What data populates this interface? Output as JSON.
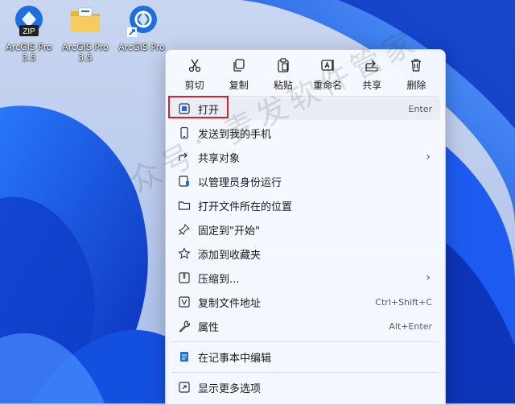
{
  "desktop": {
    "icons": [
      {
        "badge": "ZIP",
        "label": "ArcGIS Pro 3.5"
      },
      {
        "label": "ArcGIS Pro 3.5"
      },
      {
        "label": "ArcGIS Pro"
      }
    ]
  },
  "toolbar": {
    "cut": "剪切",
    "copy": "复制",
    "paste": "粘贴",
    "rename": "重命名",
    "share": "共享",
    "delete": "删除"
  },
  "menu": {
    "items": [
      {
        "label": "打开",
        "shortcut": "Enter"
      },
      {
        "label": "发送到我的手机"
      },
      {
        "label": "共享对象"
      },
      {
        "label": "以管理员身份运行"
      },
      {
        "label": "打开文件所在的位置"
      },
      {
        "label": "固定到\"开始\""
      },
      {
        "label": "添加到收藏夹"
      },
      {
        "label": "压缩到..."
      },
      {
        "label": "复制文件地址",
        "shortcut": "Ctrl+Shift+C"
      },
      {
        "label": "属性",
        "shortcut": "Alt+Enter"
      },
      {
        "label": "在记事本中编辑"
      },
      {
        "label": "显示更多选项"
      }
    ]
  },
  "watermark": "众号：麦发软件管家",
  "colors": {
    "accent": "#1a6fe0",
    "highlight_border": "#e02020",
    "wallpaper": "#1f5fe0"
  }
}
